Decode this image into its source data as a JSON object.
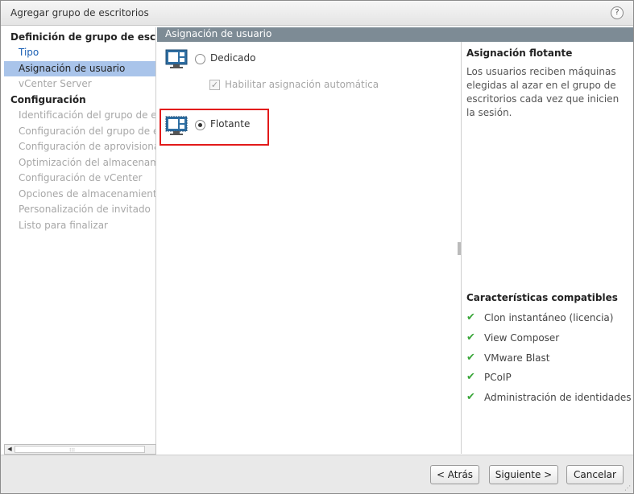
{
  "window": {
    "title": "Agregar grupo de escritorios",
    "help_label": "?"
  },
  "nav": {
    "items": [
      {
        "label": "Definición de grupo de escritorios",
        "state": "header"
      },
      {
        "label": "Tipo",
        "state": "link"
      },
      {
        "label": "Asignación de usuario",
        "state": "selected"
      },
      {
        "label": "vCenter Server",
        "state": "disabled"
      },
      {
        "label": "Configuración",
        "state": "header"
      },
      {
        "label": "Identificación del grupo de escritorios",
        "state": "disabled"
      },
      {
        "label": "Configuración del grupo de escritorios",
        "state": "disabled"
      },
      {
        "label": "Configuración de aprovisionamiento",
        "state": "disabled"
      },
      {
        "label": "Optimización del almacenamiento",
        "state": "disabled"
      },
      {
        "label": "Configuración de vCenter",
        "state": "disabled"
      },
      {
        "label": "Opciones de almacenamiento",
        "state": "disabled"
      },
      {
        "label": "Personalización de invitado",
        "state": "disabled"
      },
      {
        "label": "Listo para finalizar",
        "state": "disabled"
      }
    ],
    "scroll_grip": ":::"
  },
  "main": {
    "header": "Asignación de usuario",
    "options": {
      "dedicated": {
        "label": "Dedicado",
        "selected": false
      },
      "auto_assign": {
        "label": "Habilitar asignación automática",
        "checked": true,
        "disabled": true
      },
      "floating": {
        "label": "Flotante",
        "selected": true
      }
    }
  },
  "info": {
    "title": "Asignación flotante",
    "description": "Los usuarios reciben máquinas elegidas al azar en el grupo de escritorios cada vez que inicien la sesión.",
    "features_title": "Características compatibles",
    "features": [
      "Clon instantáneo (licencia)",
      "View Composer",
      "VMware Blast",
      "PCoIP",
      "Administración de identidades"
    ]
  },
  "footer": {
    "back_label": "< Atrás",
    "next_label": "Siguiente >",
    "cancel_label": "Cancelar"
  },
  "colors": {
    "accent_selected": "#a9c4ea",
    "header_bar": "#7d8b95",
    "highlight": "#e21a1a",
    "check_green": "#3aa63a",
    "link_blue": "#1a5fb4"
  }
}
